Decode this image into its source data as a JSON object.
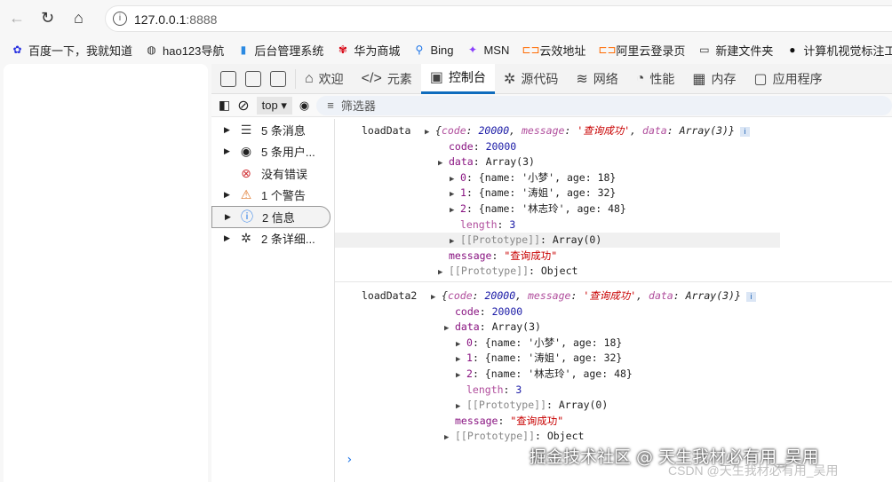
{
  "browser": {
    "url_host": "127.0.0.1",
    "url_port": ":8888"
  },
  "bookmarks": [
    {
      "label": "百度一下，我就知道",
      "icon": "baidu-icon",
      "color": "#2932e1",
      "glyph": "✿"
    },
    {
      "label": "hao123导航",
      "icon": "globe-icon",
      "color": "#333",
      "glyph": "◍"
    },
    {
      "label": "后台管理系统",
      "icon": "app-icon",
      "color": "#2b8ae2",
      "glyph": "▮"
    },
    {
      "label": "华为商城",
      "icon": "huawei-icon",
      "color": "#d7000f",
      "glyph": "✾"
    },
    {
      "label": "Bing",
      "icon": "search-icon",
      "color": "#1a73e8",
      "glyph": "⚲"
    },
    {
      "label": "MSN",
      "icon": "msn-icon",
      "color": "#8a3ffc",
      "glyph": "✦"
    },
    {
      "label": "云效地址",
      "icon": "aliyun-icon",
      "color": "#ff6a00",
      "glyph": "⊏⊐"
    },
    {
      "label": "阿里云登录页",
      "icon": "aliyun-icon",
      "color": "#ff6a00",
      "glyph": "⊏⊐"
    },
    {
      "label": "新建文件夹",
      "icon": "folder-icon",
      "color": "#333",
      "glyph": "▭"
    },
    {
      "label": "计算机视觉标注工具",
      "icon": "app-icon",
      "color": "#111",
      "glyph": "●"
    }
  ],
  "devtools": {
    "tabs": [
      {
        "label": "欢迎",
        "icon": "home-icon",
        "glyph": "⌂"
      },
      {
        "label": "元素",
        "icon": "code-icon",
        "glyph": "</>"
      },
      {
        "label": "控制台",
        "icon": "console-icon",
        "glyph": "▣",
        "active": true
      },
      {
        "label": "源代码",
        "icon": "bug-icon",
        "glyph": "✲"
      },
      {
        "label": "网络",
        "icon": "wifi-icon",
        "glyph": "≋"
      },
      {
        "label": "性能",
        "icon": "gauge-icon",
        "glyph": "◔"
      },
      {
        "label": "内存",
        "icon": "chip-icon",
        "glyph": "▦"
      },
      {
        "label": "应用程序",
        "icon": "app-icon",
        "glyph": "▢"
      }
    ],
    "context": "top",
    "filter_placeholder": "筛选器",
    "sidebar": [
      {
        "label": "5 条消息",
        "icon": "list-icon",
        "glyph": "☰",
        "color": "#444",
        "arrow": true
      },
      {
        "label": "5 条用户...",
        "icon": "user-icon",
        "glyph": "◉",
        "color": "#222",
        "arrow": true
      },
      {
        "label": "没有错误",
        "icon": "error-icon",
        "glyph": "⊗",
        "color": "#d13438",
        "arrow": false
      },
      {
        "label": "1 个警告",
        "icon": "warning-icon",
        "glyph": "⚠",
        "color": "#e07a2e",
        "arrow": true
      },
      {
        "label": "2 信息",
        "icon": "info-icon",
        "glyph": "ⓘ",
        "color": "#1a73e8",
        "arrow": true,
        "selected": true
      },
      {
        "label": "2 条详细...",
        "icon": "bug-icon",
        "glyph": "✲",
        "color": "#333",
        "arrow": true
      }
    ],
    "console": [
      {
        "label": "loadData",
        "summary": [
          "{",
          "code",
          ": ",
          "20000",
          ", ",
          "message",
          ": ",
          "'查询成功'",
          ", ",
          "data",
          ": Array(3)}"
        ],
        "lines": [
          {
            "lvl": 0,
            "arrow": false,
            "key": "code",
            "val": "20000",
            "vt": "num"
          },
          {
            "lvl": 0,
            "arrow": true,
            "key": "data",
            "val": "Array(3)",
            "vt": ""
          },
          {
            "lvl": 1,
            "arrow": true,
            "key": "0",
            "val": "{name: '小梦', age: 18}",
            "vt": "obj"
          },
          {
            "lvl": 1,
            "arrow": true,
            "key": "1",
            "val": "{name: '涛姐', age: 32}",
            "vt": "obj"
          },
          {
            "lvl": 1,
            "arrow": true,
            "key": "2",
            "val": "{name: '林志玲', age: 48}",
            "vt": "obj"
          },
          {
            "lvl": 1,
            "arrow": false,
            "key": "length",
            "val": "3",
            "vt": "num",
            "dim": true
          },
          {
            "lvl": 1,
            "arrow": true,
            "key": "[[Prototype]]",
            "val": "Array(0)",
            "vt": "",
            "gray": true,
            "hl": true
          },
          {
            "lvl": 0,
            "arrow": false,
            "key": "message",
            "val": "\"查询成功\"",
            "vt": "str"
          },
          {
            "lvl": 0,
            "arrow": true,
            "key": "[[Prototype]]",
            "val": "Object",
            "vt": "",
            "gray": true
          }
        ]
      },
      {
        "label": "loadData2",
        "summary": [
          "{",
          "code",
          ": ",
          "20000",
          ", ",
          "message",
          ": ",
          "'查询成功'",
          ", ",
          "data",
          ": Array(3)}"
        ],
        "lines": [
          {
            "lvl": 0,
            "arrow": false,
            "key": "code",
            "val": "20000",
            "vt": "num"
          },
          {
            "lvl": 0,
            "arrow": true,
            "key": "data",
            "val": "Array(3)",
            "vt": ""
          },
          {
            "lvl": 1,
            "arrow": true,
            "key": "0",
            "val": "{name: '小梦', age: 18}",
            "vt": "obj"
          },
          {
            "lvl": 1,
            "arrow": true,
            "key": "1",
            "val": "{name: '涛姐', age: 32}",
            "vt": "obj"
          },
          {
            "lvl": 1,
            "arrow": true,
            "key": "2",
            "val": "{name: '林志玲', age: 48}",
            "vt": "obj"
          },
          {
            "lvl": 1,
            "arrow": false,
            "key": "length",
            "val": "3",
            "vt": "num",
            "dim": true
          },
          {
            "lvl": 1,
            "arrow": true,
            "key": "[[Prototype]]",
            "val": "Array(0)",
            "vt": "",
            "gray": true
          },
          {
            "lvl": 0,
            "arrow": false,
            "key": "message",
            "val": "\"查询成功\"",
            "vt": "str"
          },
          {
            "lvl": 0,
            "arrow": true,
            "key": "[[Prototype]]",
            "val": "Object",
            "vt": "",
            "gray": true
          }
        ]
      }
    ]
  },
  "watermark": {
    "text": "掘金技术社区 @ 天生我材必有用_吴用",
    "csdn": "CSDN @天生我材必有用_吴用"
  }
}
